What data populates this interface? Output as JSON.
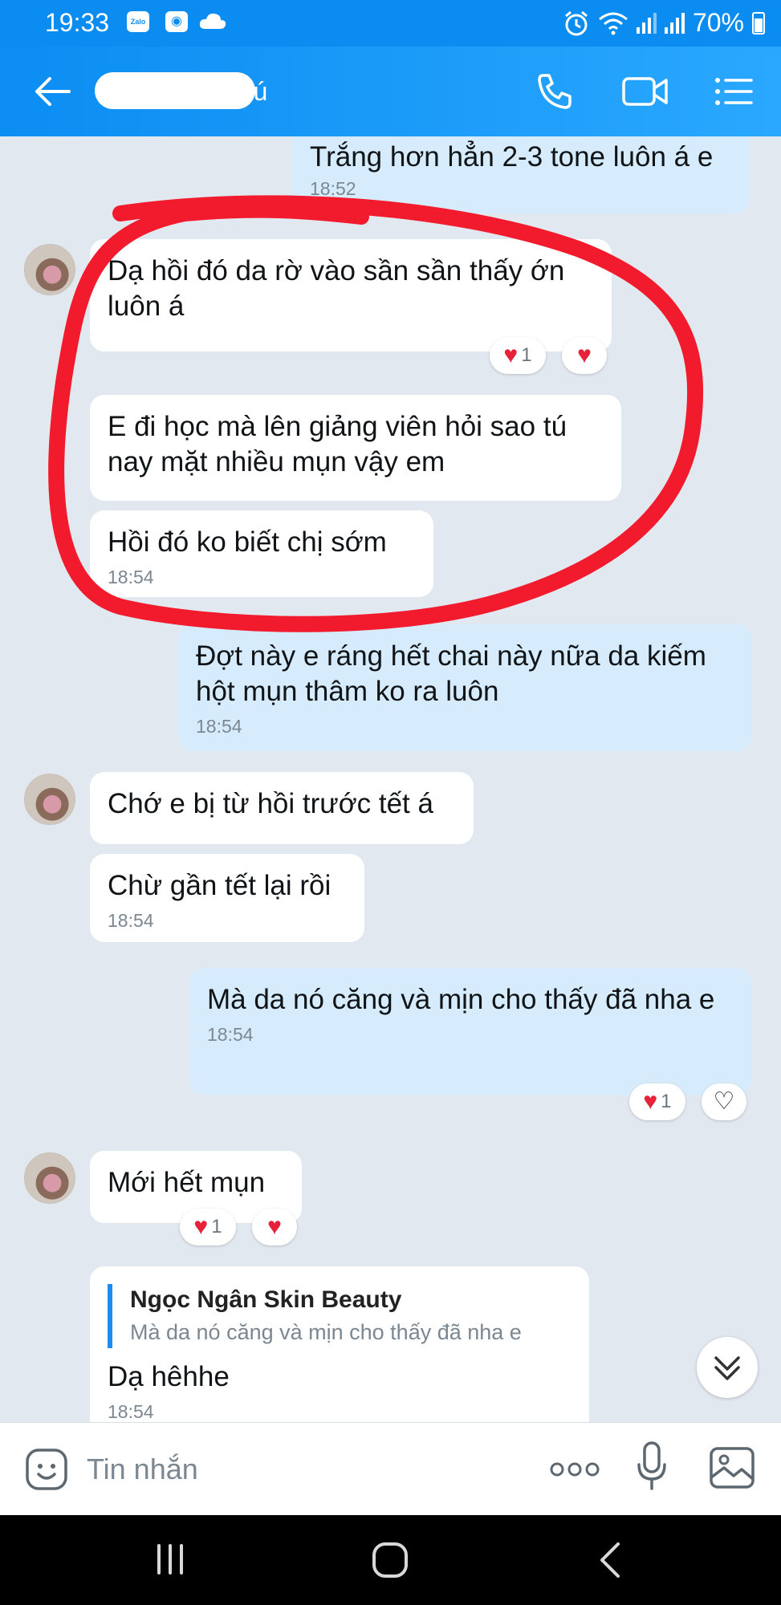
{
  "status_bar": {
    "time": "19:33",
    "app_icon_label": "Zalo",
    "battery": "70%"
  },
  "header": {
    "contact_name": "Tú",
    "icons": [
      "back-arrow-icon",
      "phone-icon",
      "video-call-icon",
      "menu-list-icon"
    ]
  },
  "messages": [
    {
      "side": "out",
      "text": "Trắng hơn hẳn 2-3 tone luôn á e",
      "time": "18:52"
    },
    {
      "side": "in",
      "text": "Dạ hồi đó da rờ vào sần sần thấy ớn luôn á",
      "reaction_count": "1"
    },
    {
      "side": "in",
      "text": "E đi học mà lên giảng viên hỏi sao tú nay mặt nhiều mụn vậy em"
    },
    {
      "side": "in",
      "text": "Hồi đó ko biết chị sớm",
      "time": "18:54"
    },
    {
      "side": "out",
      "text": "Đợt này e ráng hết chai này nữa da kiếm hột mụn thâm ko ra luôn",
      "time": "18:54"
    },
    {
      "side": "in",
      "text": "Chớ e bị từ hồi trước tết á"
    },
    {
      "side": "in",
      "text": "Chừ gần tết lại rồi",
      "time": "18:54"
    },
    {
      "side": "out",
      "text": "Mà da nó căng và mịn cho thấy đã nha e",
      "time": "18:54",
      "reaction_count": "1"
    },
    {
      "side": "in",
      "text": "Mới hết mụn",
      "reaction_count": "1"
    },
    {
      "side": "in",
      "quote_name": "Ngọc Ngân Skin Beauty",
      "quote_text": "Mà da nó căng và mịn cho thấy đã nha e",
      "text": "Dạ hêhhe",
      "time": "18:54"
    }
  ],
  "input_bar": {
    "placeholder": "Tin nhắn",
    "icons": [
      "sticker-icon",
      "more-options-icon",
      "microphone-icon",
      "image-icon"
    ]
  },
  "nav_bar": {
    "icons": [
      "recent-apps-icon",
      "home-icon",
      "back-icon"
    ]
  },
  "colors": {
    "header_blue": "#0b8df2",
    "outgoing_bubble": "#d6ecfd",
    "incoming_bubble": "#ffffff",
    "chat_background": "#e2e8ef",
    "annotation_red": "#f21b2d",
    "heart_red": "#e8213a"
  }
}
